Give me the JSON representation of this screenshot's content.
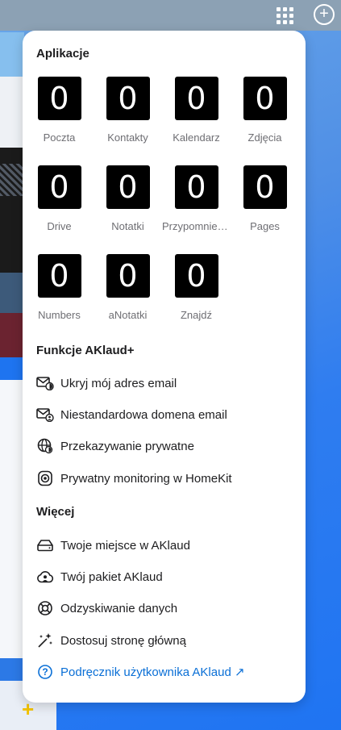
{
  "topbar": {
    "grid_icon": "app-grid-icon",
    "plus_icon": "add-circle-icon"
  },
  "apps_section": {
    "title": "Aplikacje",
    "apps": [
      {
        "badge": "0",
        "label": "Poczta"
      },
      {
        "badge": "0",
        "label": "Kontakty"
      },
      {
        "badge": "0",
        "label": "Kalendarz"
      },
      {
        "badge": "0",
        "label": "Zdjęcia"
      },
      {
        "badge": "0",
        "label": "Drive"
      },
      {
        "badge": "0",
        "label": "Notatki"
      },
      {
        "badge": "0",
        "label": "Przypomnienia"
      },
      {
        "badge": "0",
        "label": "Pages"
      },
      {
        "badge": "0",
        "label": "Numbers"
      },
      {
        "badge": "0",
        "label": "aNotatki"
      },
      {
        "badge": "0",
        "label": "Znajdź"
      }
    ]
  },
  "features_section": {
    "title": "Funkcje AKlaud+",
    "items": [
      {
        "label": "Ukryj mój adres email",
        "icon": "hide-email-icon"
      },
      {
        "label": "Niestandardowa domena email",
        "icon": "custom-domain-email-icon"
      },
      {
        "label": "Przekazywanie prywatne",
        "icon": "private-relay-globe-icon"
      },
      {
        "label": "Prywatny monitoring w HomeKit",
        "icon": "homekit-camera-icon"
      }
    ]
  },
  "more_section": {
    "title": "Więcej",
    "items": [
      {
        "label": "Twoje miejsce w AKlaud",
        "icon": "storage-drive-icon"
      },
      {
        "label": "Twój pakiet AKlaud",
        "icon": "cloud-user-icon"
      },
      {
        "label": "Odzyskiwanie danych",
        "icon": "lifebuoy-icon"
      },
      {
        "label": "Dostosuj stronę główną",
        "icon": "sparkles-icon"
      },
      {
        "label": "Podręcznik użytkownika AKlaud ↗",
        "icon": "help-circle-icon"
      }
    ]
  },
  "colors": {
    "accent": "#0a6fd6",
    "tile": "#000000",
    "add_plus": "#f3c300"
  },
  "add_icon": "add-icon"
}
